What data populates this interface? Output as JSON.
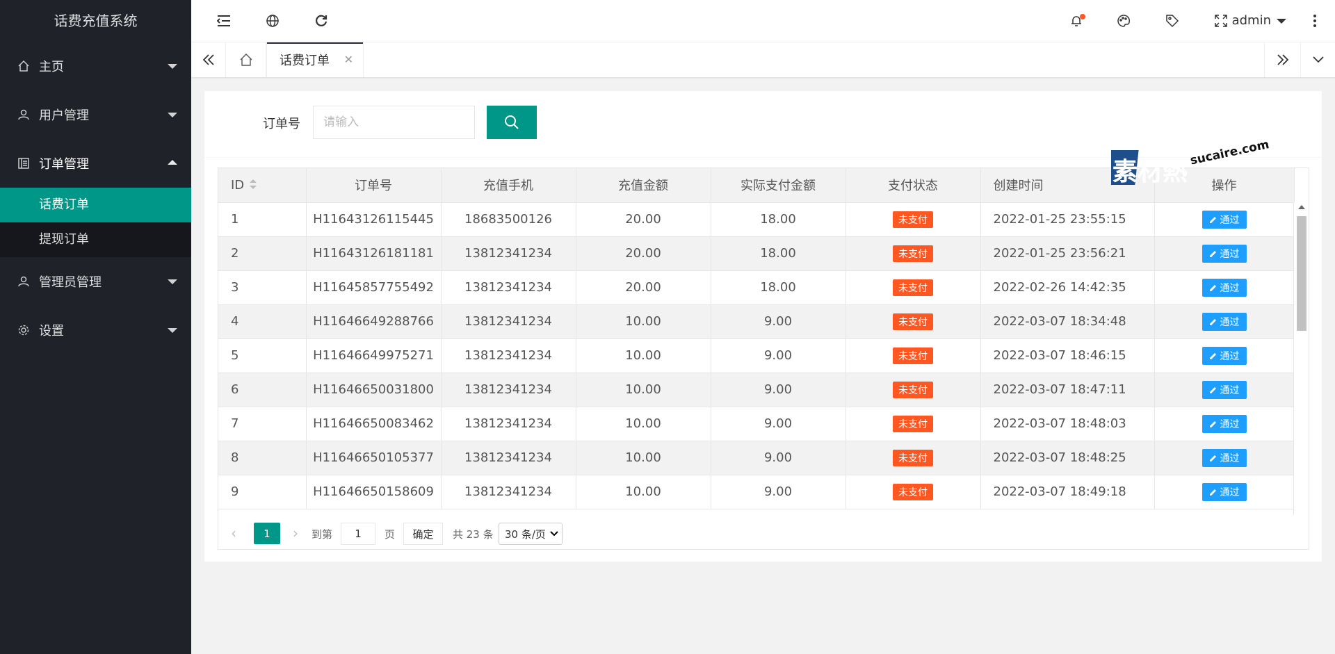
{
  "app": {
    "title": "话费充值系统",
    "accent": "#009688"
  },
  "sidebar": {
    "items": [
      {
        "label": "主页",
        "icon": "home-icon"
      },
      {
        "label": "用户管理",
        "icon": "user-icon"
      },
      {
        "label": "订单管理",
        "icon": "order-icon",
        "open": true,
        "children": [
          {
            "label": "话费订单",
            "active": true
          },
          {
            "label": "提现订单"
          }
        ]
      },
      {
        "label": "管理员管理",
        "icon": "user-icon"
      },
      {
        "label": "设置",
        "icon": "gear-icon"
      }
    ]
  },
  "header": {
    "user": "admin"
  },
  "tabs": {
    "active": "话费订单"
  },
  "search": {
    "label": "订单号",
    "placeholder": "请输入",
    "value": ""
  },
  "table": {
    "columns": [
      "ID",
      "订单号",
      "充值手机",
      "充值金额",
      "实际支付金额",
      "支付状态",
      "创建时间",
      "操作"
    ],
    "action_label": "通过",
    "rows": [
      {
        "id": "1",
        "order": "H11643126115445",
        "phone": "18683500126",
        "amount": "20.00",
        "paid": "18.00",
        "status": "未支付",
        "time": "2022-01-25 23:55:15"
      },
      {
        "id": "2",
        "order": "H11643126181181",
        "phone": "13812341234",
        "amount": "20.00",
        "paid": "18.00",
        "status": "未支付",
        "time": "2022-01-25 23:56:21"
      },
      {
        "id": "3",
        "order": "H11645857755492",
        "phone": "13812341234",
        "amount": "20.00",
        "paid": "18.00",
        "status": "未支付",
        "time": "2022-02-26 14:42:35"
      },
      {
        "id": "4",
        "order": "H11646649288766",
        "phone": "13812341234",
        "amount": "10.00",
        "paid": "9.00",
        "status": "未支付",
        "time": "2022-03-07 18:34:48"
      },
      {
        "id": "5",
        "order": "H11646649975271",
        "phone": "13812341234",
        "amount": "10.00",
        "paid": "9.00",
        "status": "未支付",
        "time": "2022-03-07 18:46:15"
      },
      {
        "id": "6",
        "order": "H11646650031800",
        "phone": "13812341234",
        "amount": "10.00",
        "paid": "9.00",
        "status": "未支付",
        "time": "2022-03-07 18:47:11"
      },
      {
        "id": "7",
        "order": "H11646650083462",
        "phone": "13812341234",
        "amount": "10.00",
        "paid": "9.00",
        "status": "未支付",
        "time": "2022-03-07 18:48:03"
      },
      {
        "id": "8",
        "order": "H11646650105377",
        "phone": "13812341234",
        "amount": "10.00",
        "paid": "9.00",
        "status": "未支付",
        "time": "2022-03-07 18:48:25"
      },
      {
        "id": "9",
        "order": "H11646650158609",
        "phone": "13812341234",
        "amount": "10.00",
        "paid": "9.00",
        "status": "未支付",
        "time": "2022-03-07 18:49:18"
      }
    ]
  },
  "pager": {
    "current": "1",
    "goto_label": "到第",
    "page_input": "1",
    "page_unit": "页",
    "ok_label": "确定",
    "total": "共 23 条",
    "page_size": "30 条/页"
  },
  "watermark": {
    "cn": "素材熱",
    "en": "sucaire.com"
  }
}
